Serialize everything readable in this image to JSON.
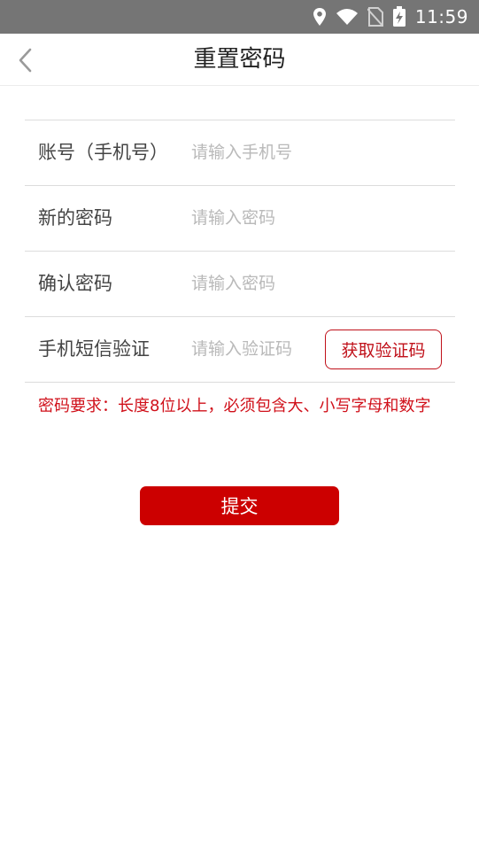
{
  "status_bar": {
    "time": "11:59"
  },
  "header": {
    "title": "重置密码"
  },
  "form": {
    "rows": [
      {
        "label": "账号（手机号）",
        "placeholder": "请输入手机号",
        "value": ""
      },
      {
        "label": "新的密码",
        "placeholder": "请输入密码",
        "value": ""
      },
      {
        "label": "确认密码",
        "placeholder": "请输入密码",
        "value": ""
      },
      {
        "label": "手机短信验证",
        "placeholder": "请输入验证码",
        "value": ""
      }
    ],
    "get_code_label": "获取验证码"
  },
  "hint": "密码要求：长度8位以上，必须包含大、小写字母和数字",
  "submit_label": "提交",
  "colors": {
    "accent": "#cc0000",
    "hint": "#d0101a",
    "status_bar": "#757575"
  }
}
